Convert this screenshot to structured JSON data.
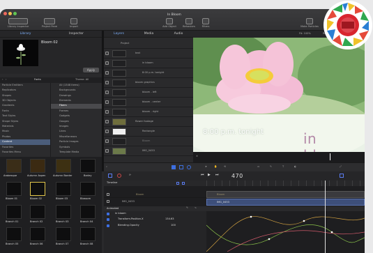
{
  "window": {
    "title": "In Bloom"
  },
  "toolbar": {
    "left": [
      "Library",
      "Inspector",
      "Project Pane",
      "Import"
    ],
    "center": [
      "Add Object",
      "Behaviors",
      "Filters"
    ],
    "right": [
      "Make Particles"
    ]
  },
  "left_tabs": [
    "Library",
    "Inspector"
  ],
  "preview": {
    "title": "Bloom 02",
    "apply": "Apply"
  },
  "library_bar": {
    "left": "Fonts",
    "right": "Theme: All"
  },
  "library_categories": [
    "Particle Emitters",
    "Replicators",
    "Shapes",
    "3D Objects",
    "Gradients",
    "Fonts",
    "Text Styles",
    "Shape Styles",
    "Materials",
    "Music",
    "Photos",
    "Content",
    "Favorites",
    "Favorites Menu"
  ],
  "library_subcategories": [
    "All (1348 items)",
    "Backgrounds",
    "Drawings",
    "Elements",
    "Fibers",
    "Frames",
    "Gadgets",
    "Gauges",
    "Images",
    "Lines",
    "Miscellaneous",
    "Particle Images",
    "Symbols",
    "Template Media"
  ],
  "content_tiles": [
    "Arabesque",
    "Autumn Aspen",
    "Autumn Border",
    "Barley",
    "Bloom 01",
    "Bloom 02",
    "Bloom 03",
    "Blossom",
    "Branch 01",
    "Branch 02",
    "Branch 03",
    "Branch 04",
    "Branch 05",
    "Branch 06",
    "Branch 07",
    "Branch 08"
  ],
  "center_tabs": [
    "Layers",
    "Media",
    "Audio"
  ],
  "viewer_bar": {
    "fit": "Fit: 100%",
    "render": "Render",
    "view": "View"
  },
  "layers": [
    {
      "name": "Project",
      "indent": 0
    },
    {
      "name": "text",
      "indent": 1
    },
    {
      "name": "in bloom",
      "indent": 2
    },
    {
      "name": "8:00 p.m. tonight",
      "indent": 2
    },
    {
      "name": "bloom graphics",
      "indent": 1
    },
    {
      "name": "bloom - left",
      "indent": 2
    },
    {
      "name": "bloom - center",
      "indent": 2
    },
    {
      "name": "bloom - right",
      "indent": 2
    },
    {
      "name": "flower footage",
      "indent": 1
    },
    {
      "name": "Rectangle",
      "indent": 2
    },
    {
      "name": "Bloom",
      "indent": 2
    },
    {
      "name": "IMG_0453",
      "indent": 2
    }
  ],
  "canvas": {
    "time_text": "8:00 p.m. tonight",
    "title_text": "in bloom"
  },
  "transport": {
    "timecode": "470"
  },
  "timeline": {
    "label": "Timeline",
    "rows": [
      "Bloom",
      "IMG_0453"
    ],
    "clips": [
      "Bloom",
      "IMG_0453"
    ]
  },
  "keyframes": {
    "label": "Animated",
    "group": "in bloom",
    "params": [
      {
        "name": "Transform.Position.X",
        "value": "134.63"
      },
      {
        "name": "Blending.Opacity",
        "value": "100"
      }
    ]
  },
  "badge": {
    "label": "badge"
  }
}
